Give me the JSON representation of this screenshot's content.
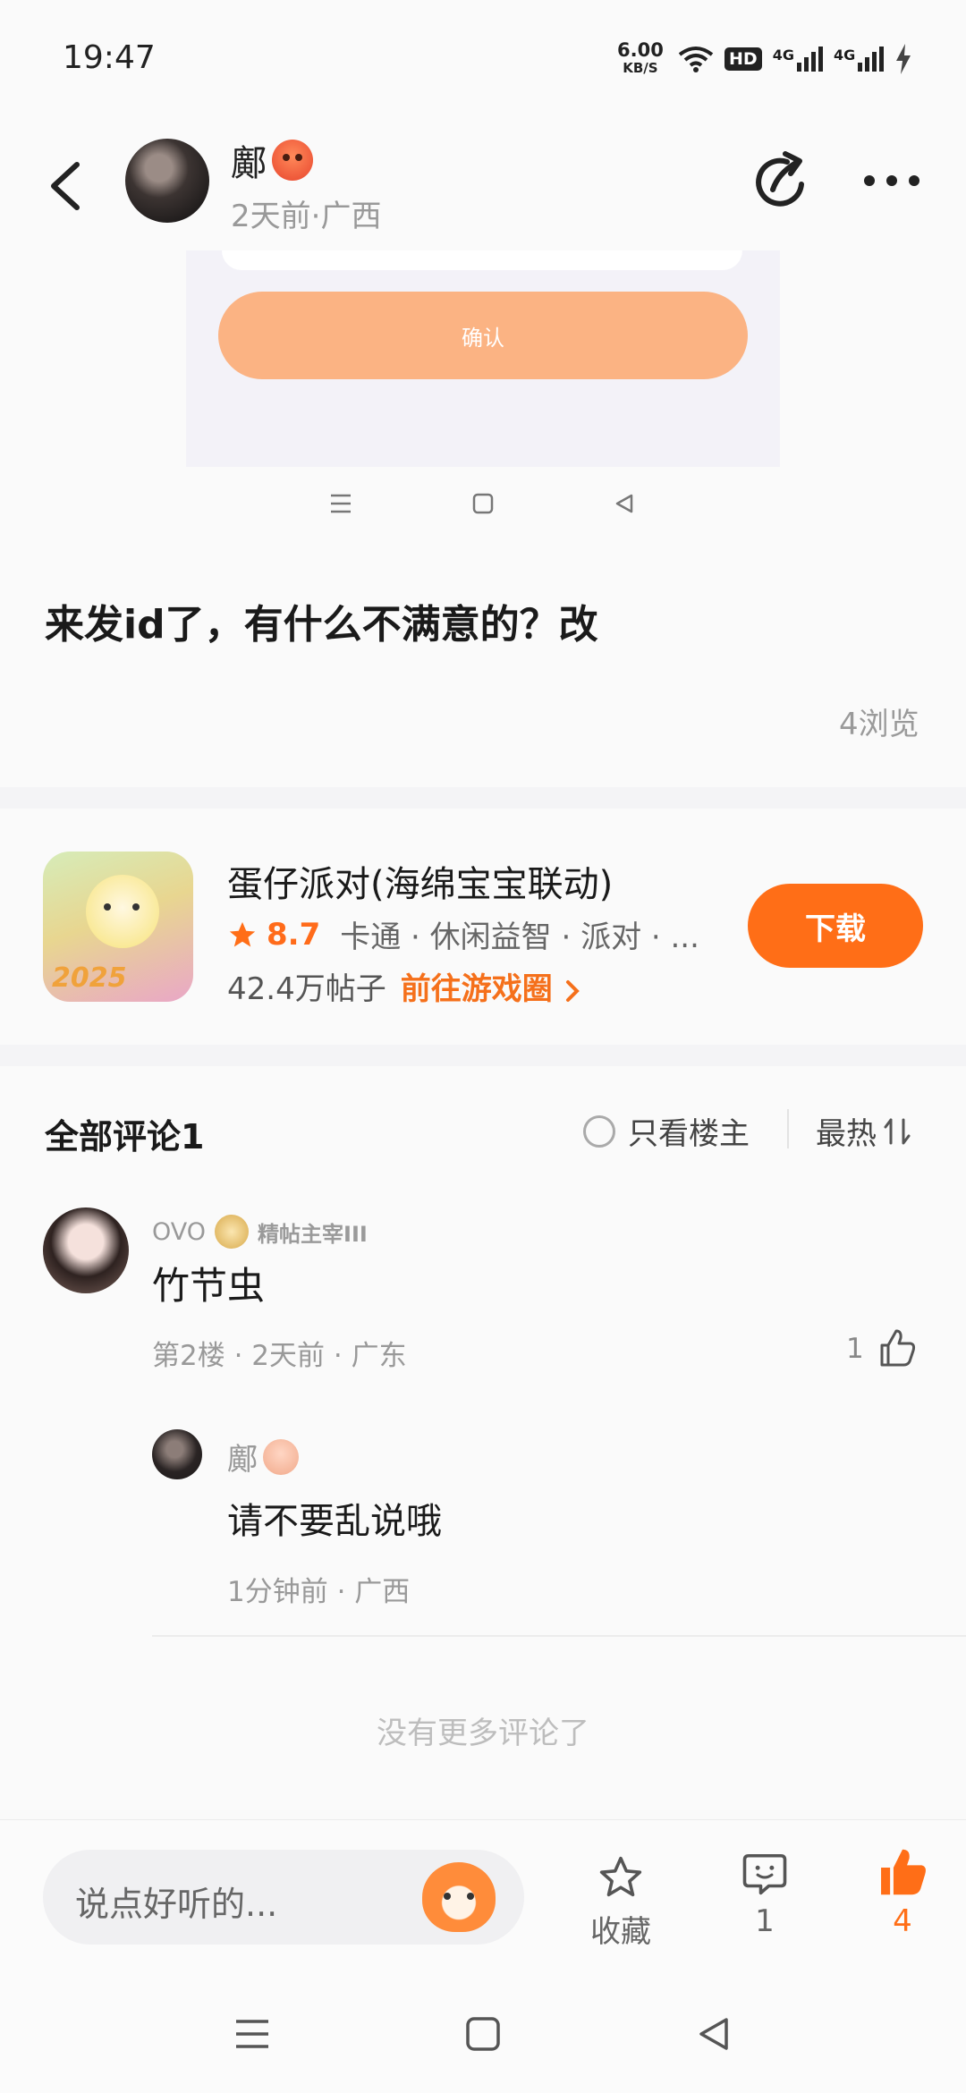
{
  "status_bar": {
    "time": "19:47",
    "net_speed_value": "6.00",
    "net_speed_unit": "KB/S",
    "hd_label": "HD",
    "signal1_label": "4G",
    "signal2_label": "4G"
  },
  "header": {
    "author_name": "鄺",
    "author_meta": "2天前·广西"
  },
  "embed": {
    "confirm_label": "确认"
  },
  "post": {
    "text": "来发id了，有什么不满意的？改",
    "views": "4浏览"
  },
  "game": {
    "title": "蛋仔派对(海绵宝宝联动)",
    "rating": "8.7",
    "tags": "卡通 · 休闲益智 · 派对 · ...",
    "posts": "42.4万帖子",
    "goto": "前往游戏圈",
    "download": "下载",
    "icon_text": "2025"
  },
  "comments": {
    "title": "全部评论1",
    "only_op": "只看楼主",
    "sort": "最热",
    "items": [
      {
        "name": "OVO",
        "badge": "精帖主宰III",
        "text": "竹节虫",
        "meta": "第2楼 · 2天前 · 广东",
        "likes": "1"
      }
    ],
    "reply": {
      "name": "鄺",
      "text": "请不要乱说哦",
      "meta": "1分钟前 · 广西"
    },
    "no_more": "没有更多评论了"
  },
  "bottom_bar": {
    "input_placeholder": "说点好听的...",
    "favorite_label": "收藏",
    "comment_count": "1",
    "like_count": "4"
  },
  "colors": {
    "accent": "#ff6e17",
    "confirm_light": "#fbb383",
    "background": "#fafafa"
  }
}
